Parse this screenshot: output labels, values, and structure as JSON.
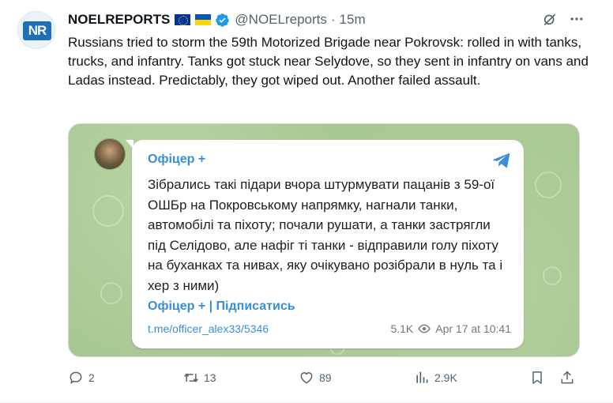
{
  "tweet": {
    "author_name": "NOELREPORTS",
    "handle": "@NOELreports",
    "separator": "·",
    "time": "15m",
    "avatar_text": "NR",
    "text": "Russians tried to storm the 59th Motorized Brigade near Pokrovsk: rolled in with tanks, trucks, and infantry. Tanks got stuck near Selydove, so they sent in infantry on vans and Ladas instead. Predictably, they got wiped out. Another failed assault."
  },
  "telegram_post": {
    "title": "Офіцер +",
    "body": "Зібрались такі підари вчора штурмувати пацанів з 59-ої ОШБр на Покровському напрямку, нагнали танки, автомобілі та піхоту; почали рушати, а танки застрягли під Селідово, але нафіг ті танки - відправили голу піхоту на буханках та нивах, яку очікувано розібрали в нуль та і хер з ними)",
    "channel_link": "Офіцер + | Підписатись",
    "url": "t.me/officer_alex33/5346",
    "views": "5.1K",
    "date": "Apr 17 at 10:41"
  },
  "actions": {
    "replies": "2",
    "reposts": "13",
    "likes": "89",
    "views": "2.9K"
  },
  "colors": {
    "accent": "#1d9bf0",
    "telegram_blue": "#3a8fd4",
    "muted": "#536471",
    "media_bg": "#a8c892"
  },
  "icons": [
    "verified-badge-icon",
    "eu-flag-icon",
    "ukraine-flag-icon",
    "grok-icon",
    "more-icon",
    "telegram-icon",
    "eye-icon",
    "reply-icon",
    "repost-icon",
    "like-icon",
    "views-icon",
    "bookmark-icon",
    "share-icon"
  ]
}
